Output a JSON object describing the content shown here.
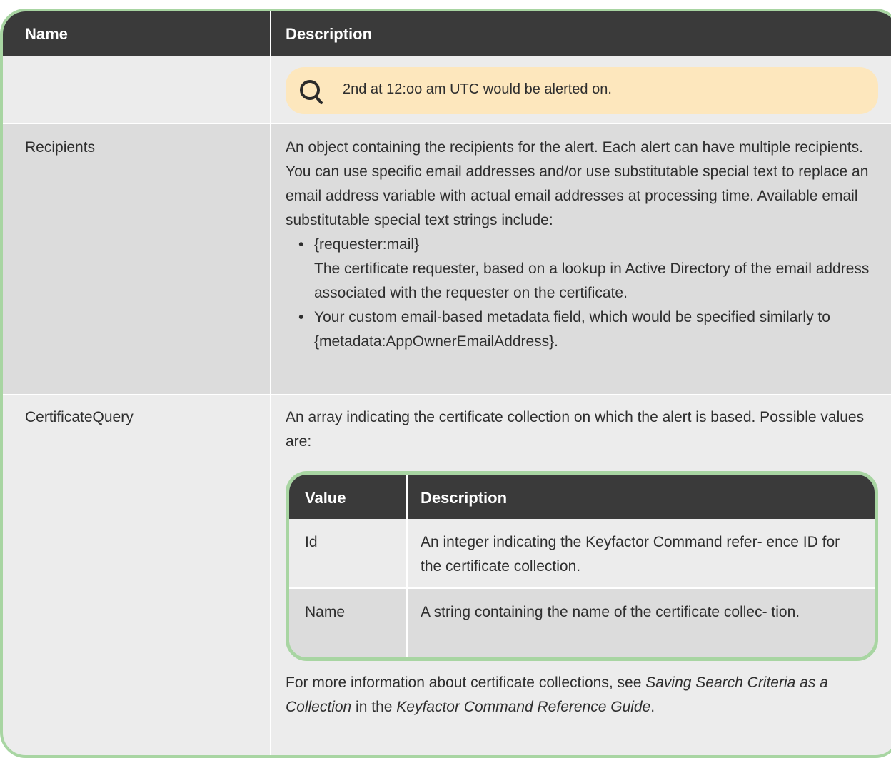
{
  "table": {
    "headers": {
      "name": "Name",
      "description": "Description"
    },
    "note": {
      "icon": "search-icon",
      "text": "2nd at 12:oo am UTC would be alerted on."
    },
    "rows": [
      {
        "name": "Recipients",
        "description": "An object containing the recipients for the alert. Each alert can have multiple recipients. You can use specific email addresses and/or use substitutable special text to replace an email address variable with actual email addresses at processing time. Available email substitutable special text strings include:",
        "bullets": [
          {
            "title": "{requester:mail}",
            "text": "The certificate requester, based on a lookup in Active Directory of the email address associated with the requester on the certificate."
          },
          {
            "title": "",
            "text": "Your custom email-based metadata field, which would be specified similarly to {metadata:AppOwnerEmailAddress}."
          }
        ]
      },
      {
        "name": "CertificateQuery",
        "description": "An array indicating the certificate collection on which the alert is based. Possible values are:",
        "subtable": {
          "headers": {
            "value": "Value",
            "description": "Description"
          },
          "rows": [
            {
              "value": "Id",
              "description": "An integer indicating the Keyfactor Command refer- ence ID for the certificate collection."
            },
            {
              "value": "Name",
              "description": "A string containing the name of the certificate collec- tion."
            }
          ]
        },
        "footer": {
          "pre": "For more information about certificate collections, see ",
          "link1": "Saving Search Criteria as a Collection",
          "mid": " in the ",
          "link2": "Keyfactor Command Reference Guide",
          "post": "."
        }
      }
    ]
  },
  "colors": {
    "header_bg": "#3a3a3a",
    "border": "#a8d5a2",
    "note_bg": "#fde7bd",
    "row_bg": "#ececec",
    "row_shade": "#dcdcdc"
  }
}
